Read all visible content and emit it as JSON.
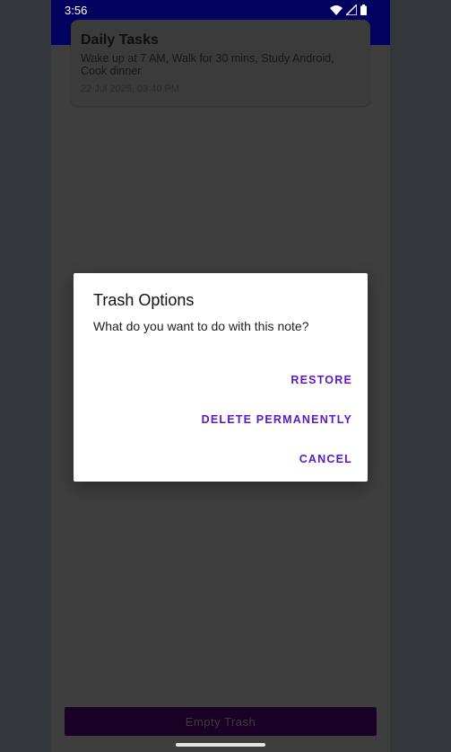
{
  "status_bar": {
    "time": "3:56",
    "icons": [
      "wifi-icon",
      "signal-icon",
      "battery-icon"
    ]
  },
  "note": {
    "title": "Daily Tasks",
    "body": "Wake up at 7 AM, Walk for 30 mins, Study Android, Cook dinner",
    "date": "22 Jul 2025, 03:40 PM"
  },
  "dialog": {
    "title": "Trash Options",
    "message": "What do you want to do with this note?",
    "restore_label": "RESTORE",
    "delete_label": "DELETE PERMANENTLY",
    "cancel_label": "CANCEL"
  },
  "bottom": {
    "empty_trash_label": "Empty Trash"
  },
  "colors": {
    "app_bar": "#01025f",
    "dialog_button": "#5a18c8",
    "empty_trash_button": "#1a0024"
  }
}
